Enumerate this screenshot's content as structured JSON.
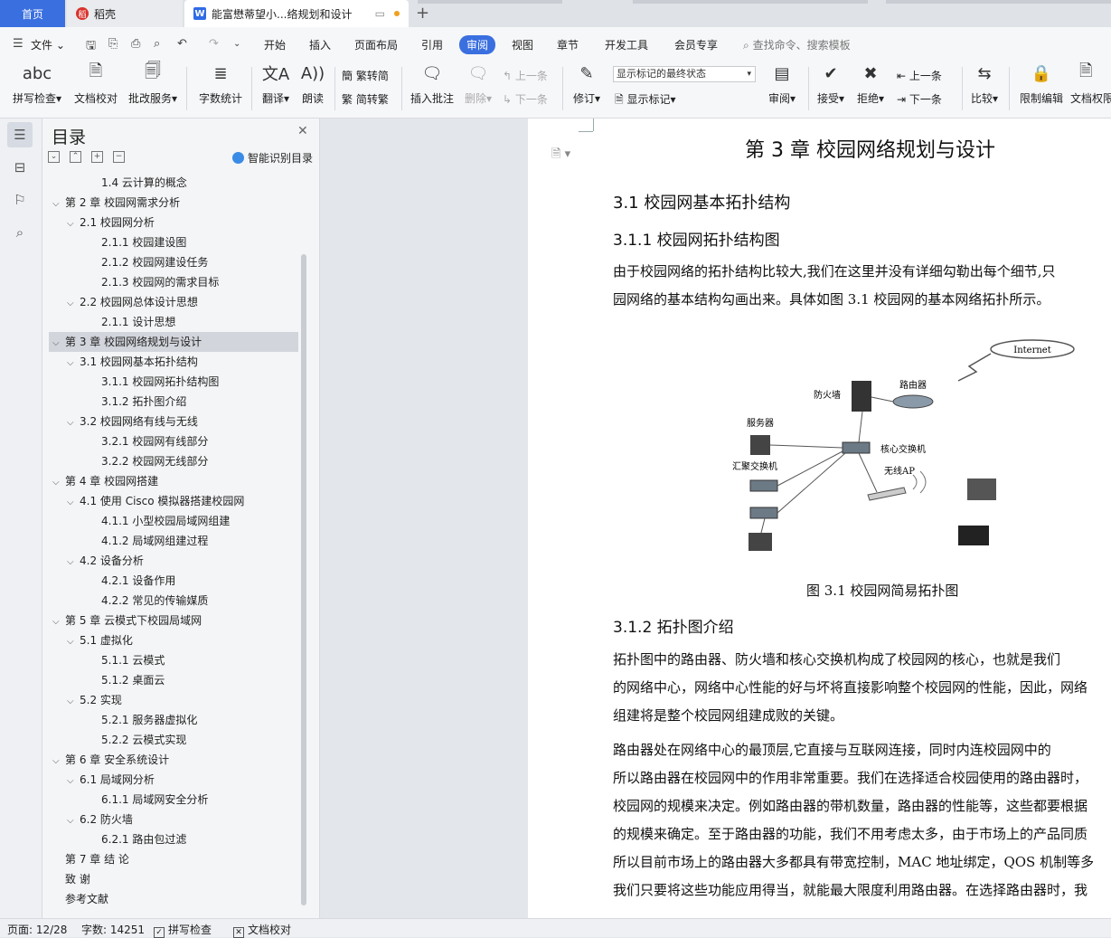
{
  "tabs": {
    "home": "首页",
    "daoke": "稻壳",
    "doc": "能富懋蒂望小...络规划和设计"
  },
  "menu": {
    "file": "文件",
    "items": [
      "开始",
      "插入",
      "页面布局",
      "引用",
      "审阅",
      "视图",
      "章节",
      "开发工具",
      "会员专享"
    ],
    "search": "查找命令、搜索模板"
  },
  "ribbon": {
    "spell": "拼写检查",
    "doc_check": "文档校对",
    "revise_service": "批改服务",
    "word_count": "字数统计",
    "translate": "翻译",
    "read": "朗读",
    "to_trad": "繁转简",
    "to_simp": "简转繁",
    "insert_comment": "插入批注",
    "delete": "删除",
    "prev_comment": "上一条",
    "next_comment": "下一条",
    "revise": "修订",
    "markup_state": "显示标记的最终状态",
    "show_markup": "显示标记",
    "review": "审阅",
    "accept": "接受",
    "reject": "拒绝",
    "prev_change": "上一条",
    "next_change": "下一条",
    "compare": "比较",
    "restrict": "限制编辑",
    "doc_permission": "文档权限"
  },
  "nav": {
    "title": "目录",
    "ai_toc": "智能识别目录",
    "items": [
      {
        "text": "1.4  云计算的概念",
        "level": 3,
        "toggle": false
      },
      {
        "text": "第 2 章    校园网需求分析",
        "level": 1,
        "toggle": true
      },
      {
        "text": "2.1  校园网分析",
        "level": 2,
        "toggle": true
      },
      {
        "text": "2.1.1  校园建设图",
        "level": 3,
        "toggle": false
      },
      {
        "text": "2.1.2  校园网建设任务",
        "level": 3,
        "toggle": false
      },
      {
        "text": "2.1.3  校园网的需求目标",
        "level": 3,
        "toggle": false
      },
      {
        "text": "2.2  校园网总体设计思想",
        "level": 2,
        "toggle": true
      },
      {
        "text": "2.1.1  设计思想",
        "level": 3,
        "toggle": false
      },
      {
        "text": "第 3 章    校园网络规划与设计",
        "level": 1,
        "toggle": true,
        "active": true
      },
      {
        "text": "3.1  校园网基本拓扑结构",
        "level": 2,
        "toggle": true
      },
      {
        "text": "3.1.1  校园网拓扑结构图",
        "level": 3,
        "toggle": false
      },
      {
        "text": "3.1.2  拓扑图介绍",
        "level": 3,
        "toggle": false
      },
      {
        "text": "3.2  校园网络有线与无线",
        "level": 2,
        "toggle": true
      },
      {
        "text": "3.2.1  校园网有线部分",
        "level": 3,
        "toggle": false
      },
      {
        "text": "3.2.2  校园网无线部分",
        "level": 3,
        "toggle": false
      },
      {
        "text": "第 4 章    校园网搭建",
        "level": 1,
        "toggle": true
      },
      {
        "text": "4.1  使用 Cisco 模拟器搭建校园网",
        "level": 2,
        "toggle": true
      },
      {
        "text": "4.1.1  小型校园局域网组建",
        "level": 3,
        "toggle": false
      },
      {
        "text": "4.1.2  局域网组建过程",
        "level": 3,
        "toggle": false
      },
      {
        "text": "4.2  设备分析",
        "level": 2,
        "toggle": true
      },
      {
        "text": "4.2.1 设备作用",
        "level": 3,
        "toggle": false
      },
      {
        "text": "4.2.2 常见的传输媒质",
        "level": 3,
        "toggle": false
      },
      {
        "text": "第 5 章    云模式下校园局域网",
        "level": 1,
        "toggle": true
      },
      {
        "text": "5.1  虚拟化",
        "level": 2,
        "toggle": true
      },
      {
        "text": "5.1.1  云模式",
        "level": 3,
        "toggle": false
      },
      {
        "text": "5.1.2  桌面云",
        "level": 3,
        "toggle": false
      },
      {
        "text": "5.2  实现",
        "level": 2,
        "toggle": true
      },
      {
        "text": "5.2.1  服务器虚拟化",
        "level": 3,
        "toggle": false
      },
      {
        "text": "5.2.2  云模式实现",
        "level": 3,
        "toggle": false
      },
      {
        "text": "第 6 章    安全系统设计",
        "level": 1,
        "toggle": true
      },
      {
        "text": "6.1  局域网分析",
        "level": 2,
        "toggle": true
      },
      {
        "text": "6.1.1  局域网安全分析",
        "level": 3,
        "toggle": false
      },
      {
        "text": "6.2  防火墙",
        "level": 2,
        "toggle": true
      },
      {
        "text": "6.2.1  路由包过滤",
        "level": 3,
        "toggle": false
      },
      {
        "text": "第 7 章    结    论",
        "level": 1,
        "toggle": false
      },
      {
        "text": "致    谢",
        "level": 1,
        "toggle": false
      },
      {
        "text": "参考文献",
        "level": 1,
        "toggle": false
      }
    ]
  },
  "document": {
    "chapter_title": "第 3 章    校园网络规划与设计",
    "h_3_1": "3.1  校园网基本拓扑结构",
    "h_3_1_1": "3.1.1  校园网拓扑结构图",
    "para1_line1": "        由于校园网络的拓扑结构比较大,我们在这里并没有详细勾勒出每个细节,只",
    "para1_line2": "园网络的基本结构勾画出来。具体如图 3.1 校园网的基本网络拓扑所示。",
    "figure": {
      "internet": "Internet",
      "router": "路由器",
      "firewall": "防火墙",
      "server": "服务器",
      "core_switch": "核心交换机",
      "agg_switch": "汇聚交换机",
      "wireless_ap": "无线AP"
    },
    "fig_caption": "图 3.1  校园网简易拓扑图",
    "h_3_1_2": "3.1.2  拓扑图介绍",
    "para2_line1": "        拓扑图中的路由器、防火墙和核心交换机构成了校园网的核心，也就是我们",
    "para2_line2": "的网络中心，网络中心性能的好与坏将直接影响整个校园网的性能，因此，网络",
    "para2_line3": "组建将是整个校园网组建成败的关键。",
    "para3_line1": "        路由器处在网络中心的最顶层,它直接与互联网连接，同时内连校园网中的",
    "para3_line2": "所以路由器在校园网中的作用非常重要。我们在选择适合校园使用的路由器时，",
    "para3_line3": "校园网的规模来决定。例如路由器的带机数量，路由器的性能等，这些都要根据",
    "para3_line4": "的规模来确定。至于路由器的功能，我们不用考虑太多，由于市场上的产品同质",
    "para3_line5": "所以目前市场上的路由器大多都具有带宽控制，MAC 地址绑定，QOS 机制等多",
    "para3_line6": "我们只要将这些功能应用得当，就能最大限度利用路由器。在选择路由器时，我"
  },
  "status": {
    "page": "页面: 12/28",
    "words": "字数: 14251",
    "spell": "拼写检查",
    "doc_check": "文档校对"
  }
}
